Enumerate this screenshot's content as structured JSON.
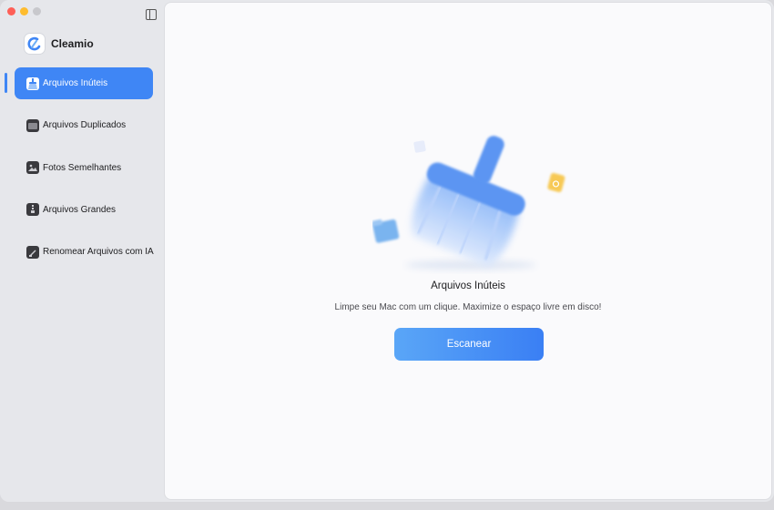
{
  "app": {
    "name": "Cleamio"
  },
  "sidebar": {
    "items": [
      {
        "label": "Arquivos Inúteis",
        "icon": "broom-icon",
        "active": true
      },
      {
        "label": "Arquivos Duplicados",
        "icon": "folder-icon",
        "active": false
      },
      {
        "label": "Fotos Semelhantes",
        "icon": "photo-icon",
        "active": false
      },
      {
        "label": "Arquivos Grandes",
        "icon": "archive-icon",
        "active": false
      },
      {
        "label": "Renomear Arquivos com IA",
        "icon": "document-icon",
        "active": false
      }
    ]
  },
  "main": {
    "title": "Arquivos Inúteis",
    "subtitle": "Limpe seu Mac com um clique. Maximize o espaço livre em disco!",
    "scan_label": "Escanear"
  },
  "colors": {
    "accent": "#3f86f5",
    "broom": "#5b95f2",
    "folder": "#79b5ef",
    "file": "#f7c955"
  }
}
